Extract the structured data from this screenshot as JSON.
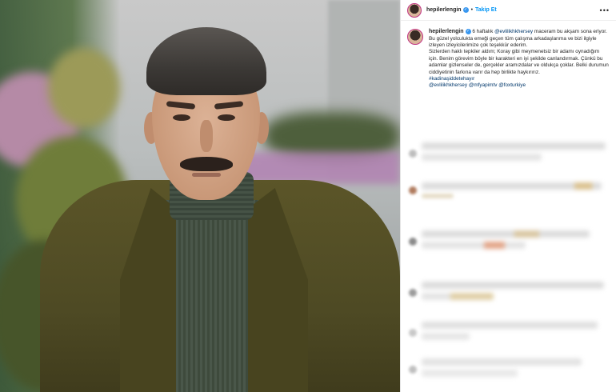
{
  "post": {
    "username": "hepilerlengin",
    "verified_mark": "✓",
    "separator": "•",
    "follow_label": "Takip Et",
    "more_label": "•••",
    "caption": {
      "username": "hepilerlengin",
      "line1_text": " 6 haftalık ",
      "line1_mention": "@evlilikhkhersey",
      "line1_end": " maceram bu akşam sona eriyor.",
      "paragraph2": "Bu güzel yolculukta emeği geçen tüm çalışma arkadaşlarıma ve bizi ilgiyle izleyen izleyicilerimize çok teşekkür ederim.",
      "paragraph3": "Sizlerden haklı tepkiler aldım; Koray gibi meymenetsiz bir adamı oynadığım için. Benim görevim böyle bir karakteri en iyi şekilde canlandırmak. Çünkü bu adamlar gizlenseler de, gerçekler aramızdalar ve oldukça çoklar. Belki durumun ciddiyetinin farkına varır da hep birlikte haykırırız.",
      "hashtag": "#kadinaşiddetehayır",
      "mentions": [
        "@evlilikhkhersey",
        "@mfyapimtv",
        "@foxturkiye"
      ]
    }
  },
  "colors": {
    "accent": "#0095f6",
    "verified": "#3897f0",
    "link": "#00376b",
    "text": "#262626"
  },
  "icons": {
    "verified": "verified-badge-icon",
    "more": "more-options-icon"
  }
}
